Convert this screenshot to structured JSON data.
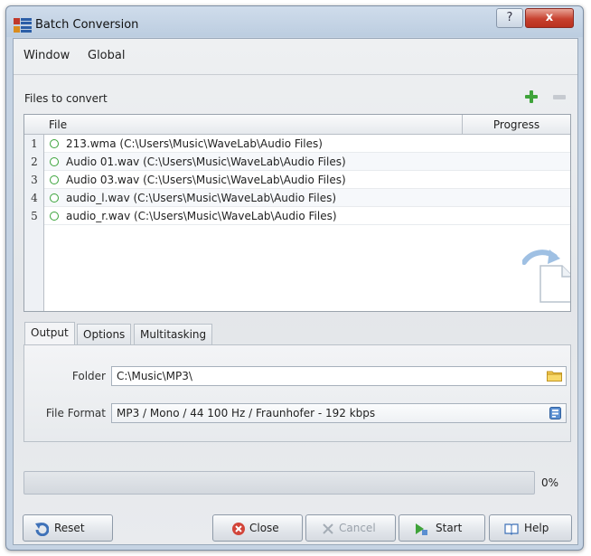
{
  "window": {
    "title": "Batch Conversion",
    "help_glyph": "?",
    "close_glyph": "x"
  },
  "menu": [
    "Window",
    "Global"
  ],
  "files_section": {
    "label": "Files to convert"
  },
  "file_table": {
    "columns": [
      "File",
      "Progress"
    ],
    "rows": [
      {
        "num": "1",
        "file": "213.wma (C:\\Users\\Music\\WaveLab\\Audio Files)",
        "progress": ""
      },
      {
        "num": "2",
        "file": "Audio 01.wav (C:\\Users\\Music\\WaveLab\\Audio Files)",
        "progress": ""
      },
      {
        "num": "3",
        "file": "Audio 03.wav (C:\\Users\\Music\\WaveLab\\Audio Files)",
        "progress": ""
      },
      {
        "num": "4",
        "file": "audio_l.wav (C:\\Users\\Music\\WaveLab\\Audio Files)",
        "progress": ""
      },
      {
        "num": "5",
        "file": "audio_r.wav (C:\\Users\\Music\\WaveLab\\Audio Files)",
        "progress": ""
      }
    ]
  },
  "tabs": [
    "Output",
    "Options",
    "Multitasking"
  ],
  "output": {
    "folder_label": "Folder",
    "folder_value": "C:\\Music\\MP3\\",
    "format_label": "File Format",
    "format_value": "MP3 / Mono / 44 100 Hz / Fraunhofer - 192 kbps"
  },
  "progress": {
    "value": 0,
    "text": "0%"
  },
  "buttons": {
    "reset": "Reset",
    "close": "Close",
    "cancel": "Cancel",
    "start": "Start",
    "help": "Help"
  },
  "colors": {
    "status_ok": "#3aa33a",
    "add_icon": "#3fa33a",
    "close_icon": "#d2453a",
    "titlebar": "#c3d2e3"
  },
  "icons": {
    "window": "batch-conversion-icon",
    "add": "plus-icon",
    "remove": "minus-icon",
    "drop": "file-arrow-icon",
    "folder": "folder-icon",
    "format": "format-settings-icon",
    "reset": "undo-icon",
    "close": "close-circle-icon",
    "cancel": "x-icon",
    "start": "play-icon",
    "help": "book-icon"
  }
}
